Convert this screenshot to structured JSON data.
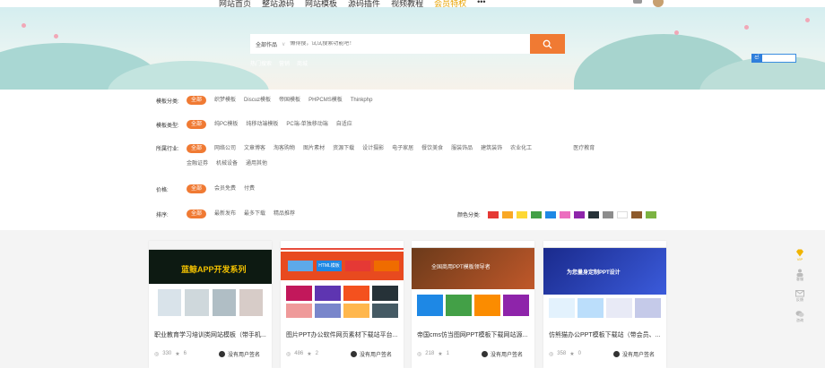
{
  "topnav": {
    "items": [
      "网站首页",
      "整站源码",
      "网站模板",
      "源码插件",
      "视频教程",
      "会员特权",
      "•••"
    ],
    "accent_index": 5
  },
  "banner": {
    "search": {
      "scope": "全部作品",
      "scope_arrow": "∨",
      "placeholder": "懒得搜，试试搜索功能吧！"
    },
    "hot_words": [
      "热门搜索",
      "营销",
      "商城"
    ],
    "cloud_label": "ඦ"
  },
  "filters": {
    "rows": [
      {
        "label": "模板分类:",
        "options": [
          "全部",
          "织梦模板",
          "Discuz模板",
          "帝国模板",
          "PHPCMS模板",
          "Thinkphp"
        ]
      },
      {
        "label": "模板类型:",
        "options": [
          "全部",
          "纯PC模板",
          "纯移动端模板",
          "PC端-单独移动端",
          "自适应"
        ]
      },
      {
        "label": "所属行业:",
        "options": [
          "全部",
          "网络公司",
          "文章博客",
          "淘客购物",
          "图片素材",
          "资源下载",
          "设计摄影",
          "电子家居",
          "餐饮美食",
          "服装饰品",
          "建筑装饰",
          "农业化工",
          "医疗教育",
          "金融证券",
          "机械设备",
          "通用其他"
        ]
      },
      {
        "label": "价格:",
        "options": [
          "全部",
          "会员免费",
          "付费"
        ]
      },
      {
        "label": "排序:",
        "options": [
          "全部",
          "最新发布",
          "最多下载",
          "精品推荐"
        ]
      }
    ],
    "color_label": "颜色分类:",
    "colors": [
      "#e53935",
      "#f9a825",
      "#fdd835",
      "#43a047",
      "#1e88e5",
      "#ec6fbf",
      "#8e24aa",
      "#263238",
      "#8d8d8d",
      "#ffffff",
      "#8d5a2b",
      "#7cb342"
    ]
  },
  "cards": [
    {
      "title": "职业教育学习培训类网站模板（带手机...",
      "views": "330",
      "likes": "6",
      "author": "没有用户签名"
    },
    {
      "title": "图片PPT办公软件网页素材下载站平台...",
      "views": "486",
      "likes": "2",
      "author": "没有用户签名"
    },
    {
      "title": "帝国cms仿当图网PPT模板下载网站源...",
      "views": "218",
      "likes": "1",
      "author": "没有用户签名"
    },
    {
      "title": "仿熊猫办公PPT模板下载站（带会员、...",
      "views": "358",
      "likes": "0",
      "author": "没有用户签名"
    }
  ],
  "card_thumbs": [
    {
      "headline": "蓝鲸APP开发系列"
    },
    {
      "headline": "HTML模板"
    },
    {
      "headline": "全国商用PPT模板领导者"
    },
    {
      "headline": "为您量身定制PPT设计"
    }
  ],
  "sidebar": {
    "items": [
      "VIP",
      "客服",
      "反馈",
      "咨询"
    ]
  }
}
